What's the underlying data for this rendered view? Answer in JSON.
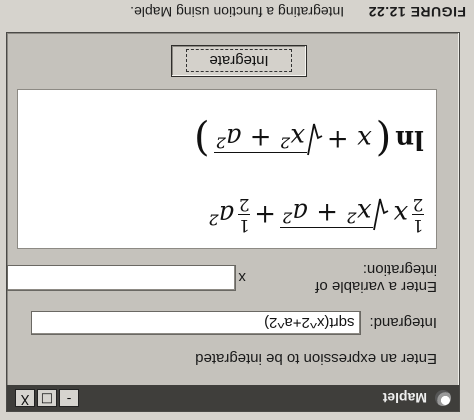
{
  "caption": {
    "figure_number": "FIGURE 12.22",
    "text": "Integrating a function using Maple."
  },
  "window": {
    "title": "Maplet",
    "controls": [
      "-",
      "□",
      "X"
    ]
  },
  "form": {
    "instruction": "Enter an expression to be integrated",
    "integrand_label": "Integrand:",
    "integrand_value": "sqrt(x^2+a^2)",
    "variable_label": "Enter a variable of integration:",
    "variable_value": "x",
    "integrate_label": "Integrate"
  },
  "result": {
    "term1_coeff_num": "1",
    "term1_coeff_den": "2",
    "term1_x": "x",
    "sqrt_body": "x² + a²",
    "plus": "+",
    "term2_coeff_num": "1",
    "term2_coeff_den": "2",
    "term2_a": "a²",
    "ln": "ln",
    "ln_arg_x": "x +",
    "ln_sqrt_body": "x² + a²"
  }
}
